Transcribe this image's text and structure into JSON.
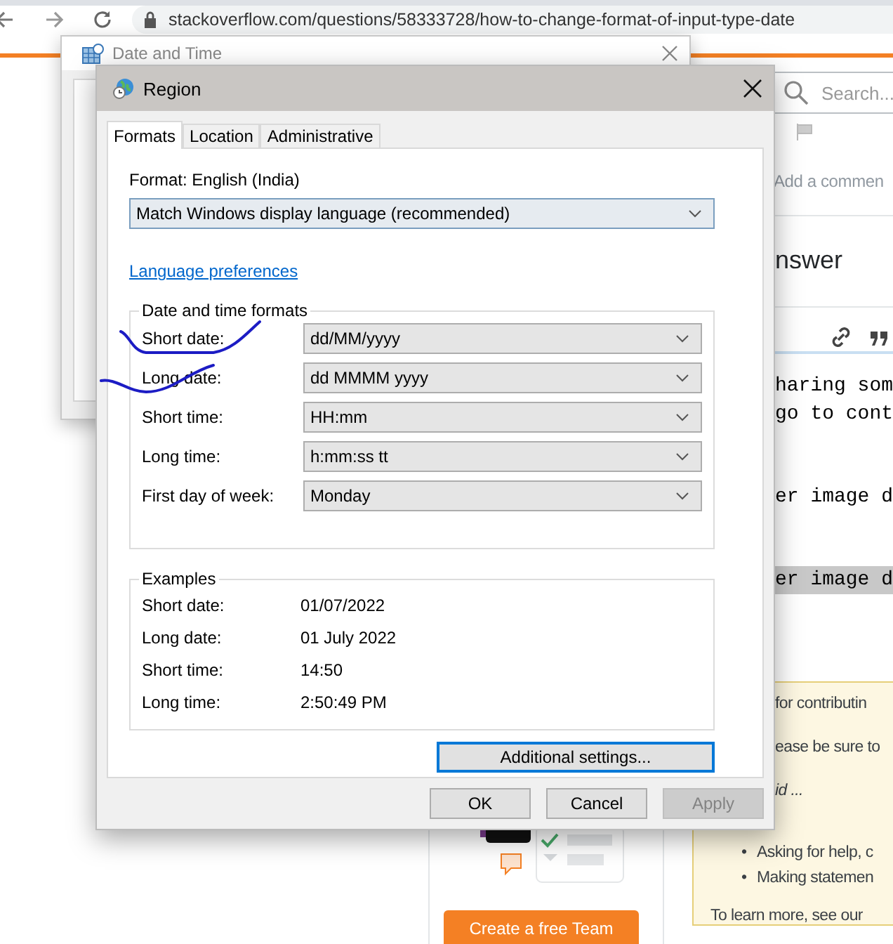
{
  "browser": {
    "url": "stackoverflow.com/questions/58333728/how-to-change-format-of-input-type-date",
    "search": {
      "placeholder": "Search..."
    },
    "comment_link": "Add a commen",
    "answer_heading": "nswer",
    "editor_lines": [
      {
        "text": "haring som",
        "highlighted": false
      },
      {
        "text": "go to cont",
        "highlighted": false
      },
      {
        "text": "er image d",
        "highlighted": false
      },
      {
        "text": "er image d",
        "highlighted": true
      }
    ],
    "notice": {
      "lines": [
        {
          "text": "for contributin",
          "kind": "plain"
        },
        {
          "text": "ease be sure to",
          "kind": "plain"
        },
        {
          "text": "id ...",
          "kind": "italic"
        }
      ],
      "bullets": [
        {
          "marker": "•",
          "text": "Asking for help, c"
        },
        {
          "marker": "•",
          "text": "Making statemen"
        }
      ],
      "footer": "To learn more, see our"
    },
    "team_button": "Create a free Team"
  },
  "date_time_window": {
    "title": "Date and Time"
  },
  "region_dialog": {
    "title": "Region",
    "tabs": [
      {
        "label": "Formats",
        "selected": true
      },
      {
        "label": "Location",
        "selected": false
      },
      {
        "label": "Administrative",
        "selected": false
      }
    ],
    "format_label": "Format: English (India)",
    "format_select": "Match Windows display language (recommended)",
    "link": "Language preferences",
    "formats_group": {
      "title": "Date and time formats",
      "rows": [
        {
          "label": "Short date:",
          "value": "dd/MM/yyyy"
        },
        {
          "label": "Long date:",
          "value": "dd MMMM yyyy"
        },
        {
          "label": "Short time:",
          "value": "HH:mm"
        },
        {
          "label": "Long time:",
          "value": "h:mm:ss tt"
        },
        {
          "label": "First day of week:",
          "value": "Monday"
        }
      ]
    },
    "examples_group": {
      "title": "Examples",
      "rows": [
        {
          "label": "Short date:",
          "value": "01/07/2022"
        },
        {
          "label": "Long date:",
          "value": "01 July 2022"
        },
        {
          "label": "Short time:",
          "value": "14:50"
        },
        {
          "label": "Long time:",
          "value": "2:50:49 PM"
        }
      ]
    },
    "additional_button": {
      "label": "Additional settings...",
      "focused": true
    },
    "buttons": [
      {
        "label": "OK",
        "disabled": false
      },
      {
        "label": "Cancel",
        "disabled": false
      },
      {
        "label": "Apply",
        "disabled": true
      }
    ]
  }
}
